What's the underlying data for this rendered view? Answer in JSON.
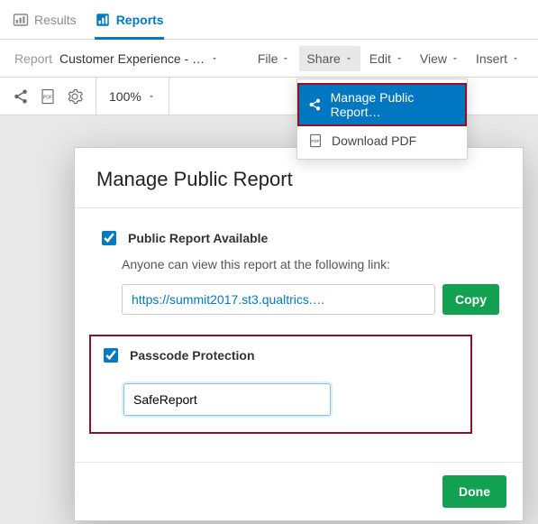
{
  "tabs": {
    "results": "Results",
    "reports": "Reports"
  },
  "toolbar": {
    "report_label": "Report",
    "report_name": "Customer Experience - …",
    "menus": {
      "file": "File",
      "share": "Share",
      "edit": "Edit",
      "view": "View",
      "insert": "Insert"
    },
    "zoom": "100%"
  },
  "share_dropdown": {
    "manage_public": "Manage Public Report…",
    "download_pdf": "Download PDF"
  },
  "modal": {
    "title": "Manage Public Report",
    "public_available_label": "Public Report Available",
    "public_help": "Anyone can view this report at the following link:",
    "link_value": "https://summit2017.st3.qualtrics.…",
    "copy": "Copy",
    "passcode_label": "Passcode Protection",
    "passcode_value": "SafeReport",
    "done": "Done"
  }
}
